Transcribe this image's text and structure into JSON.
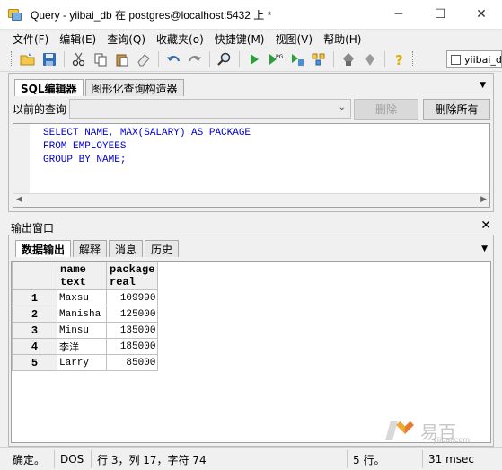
{
  "window": {
    "title": "Query - yiibai_db 在  postgres@localhost:5432 上 *",
    "minimize": "─",
    "maximize": "☐",
    "close": "✕"
  },
  "menu": [
    "文件(F)",
    "编辑(E)",
    "查询(Q)",
    "收藏夹(o)",
    "快捷键(M)",
    "视图(V)",
    "帮助(H)"
  ],
  "toolbar": {
    "db_checkbox_label": "yiibai_d"
  },
  "query_panel": {
    "tabs": [
      "SQL编辑器",
      "图形化查询构造器"
    ],
    "prev_query_label": "以前的查询",
    "delete_button": "删除",
    "delete_all_button": "删除所有",
    "sql_lines": [
      "SELECT NAME, MAX(SALARY) AS PACKAGE",
      "FROM EMPLOYEES",
      "GROUP BY NAME;"
    ]
  },
  "output_panel": {
    "title": "输出窗口",
    "tabs": [
      "数据输出",
      "解释",
      "消息",
      "历史"
    ],
    "columns": [
      {
        "name": "name",
        "type": "text"
      },
      {
        "name": "package",
        "type": "real"
      }
    ],
    "rows": [
      {
        "num": "1",
        "name": "Maxsu",
        "package": "109990"
      },
      {
        "num": "2",
        "name": "Manisha",
        "package": "125000"
      },
      {
        "num": "3",
        "name": "Minsu",
        "package": "135000"
      },
      {
        "num": "4",
        "name": "李洋",
        "package": "185000"
      },
      {
        "num": "5",
        "name": "Larry",
        "package": "85000"
      }
    ]
  },
  "watermark": {
    "text": "易百",
    "url": "yiibai.com"
  },
  "status": {
    "state": "确定。",
    "encoding": "DOS",
    "position": "行 3，列 17，字符 74",
    "rows": "5 行。",
    "time": "31 msec"
  }
}
